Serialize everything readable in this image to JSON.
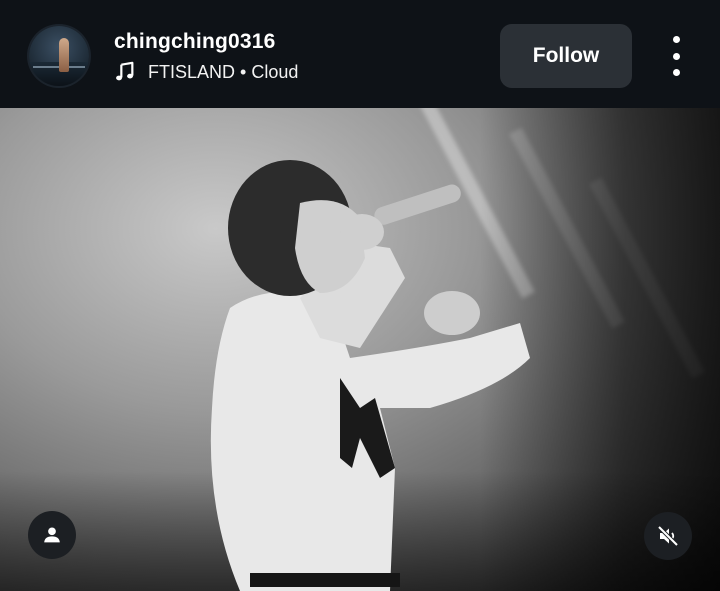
{
  "post": {
    "username": "chingching0316",
    "song": "FTISLAND • Cloud",
    "follow_label": "Follow"
  },
  "icons": {
    "music": "music-note-icon",
    "more": "more-vertical-icon",
    "user_tag": "person-icon",
    "mute": "volume-muted-icon"
  },
  "colors": {
    "header_bg": "#0e1217",
    "follow_bg": "#2b3036",
    "overlay_button_bg": "#1c1f23"
  }
}
